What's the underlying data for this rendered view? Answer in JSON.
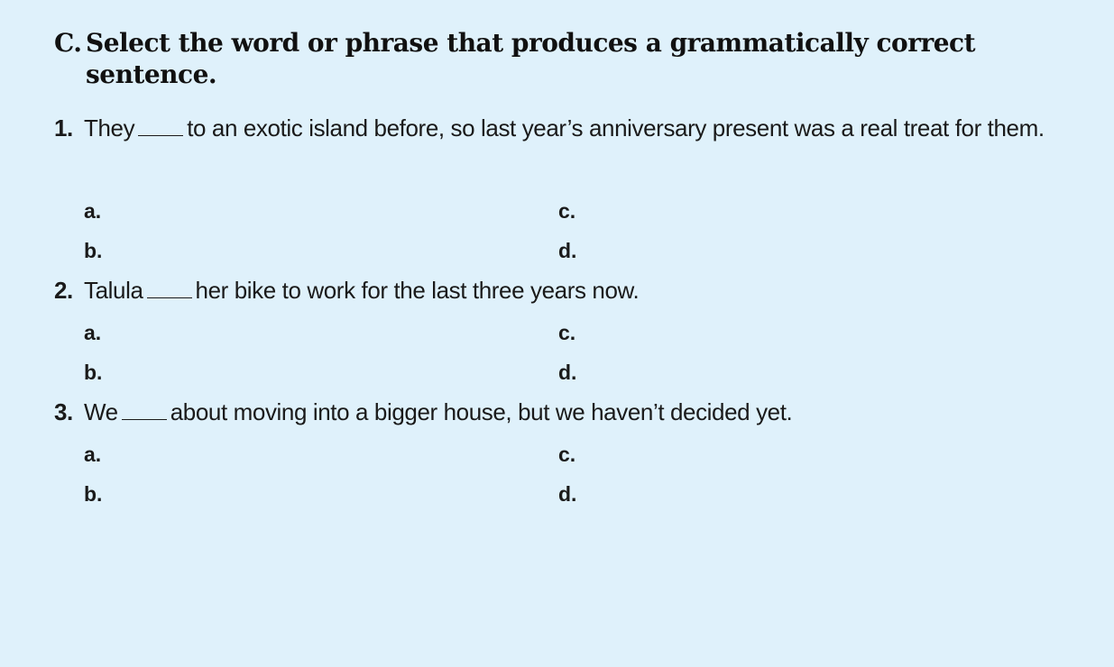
{
  "section": {
    "letter": "C.",
    "instruction": "Select the word or phrase that produces a grammatically correct sentence."
  },
  "questions": [
    {
      "number": "1.",
      "before": "They",
      "after": "to an exotic island before, so last year’s anniversary present was a real treat for them.",
      "options": [
        "a.",
        "b.",
        "c.",
        "d."
      ]
    },
    {
      "number": "2.",
      "before": "Talula",
      "after": "her bike to work for the last three years now.",
      "options": [
        "a.",
        "b.",
        "c.",
        "d."
      ]
    },
    {
      "number": "3.",
      "before": "We",
      "after": "about moving into a bigger house, but we haven’t decided yet.",
      "options": [
        "a.",
        "b.",
        "c.",
        "d."
      ]
    }
  ]
}
